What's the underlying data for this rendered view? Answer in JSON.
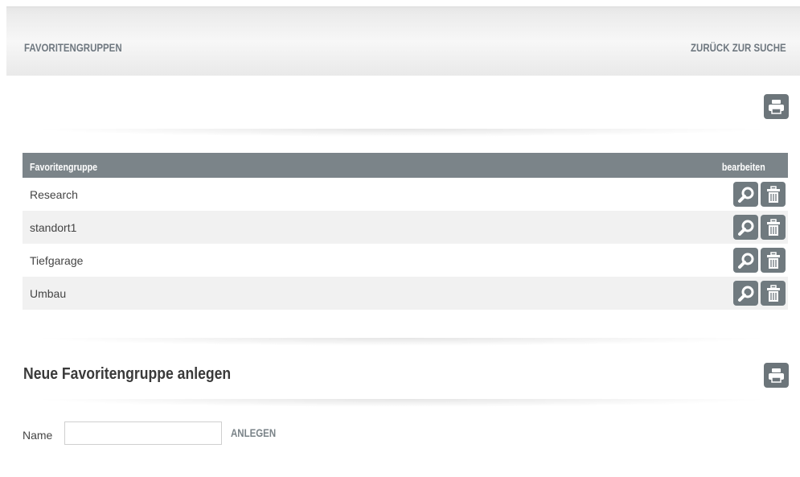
{
  "header": {
    "title": "FAVORITENGRUPPEN",
    "back_link": "ZURÜCK ZUR SUCHE"
  },
  "table": {
    "columns": [
      "Favoritengruppe",
      "bearbeiten"
    ],
    "rows": [
      {
        "name": "Research"
      },
      {
        "name": "standort1"
      },
      {
        "name": "Tiefgarage"
      },
      {
        "name": "Umbau"
      }
    ]
  },
  "new_group": {
    "title": "Neue Favoritengruppe anlegen",
    "name_label": "Name",
    "name_value": "",
    "create_label": "ANLEGEN"
  },
  "icons": {
    "print": "printer-icon",
    "search": "magnifier-icon",
    "delete": "trash-icon"
  },
  "colors": {
    "header_bg": "#7b8489",
    "button_bg": "#6c757a",
    "link_text": "#6f7880"
  }
}
